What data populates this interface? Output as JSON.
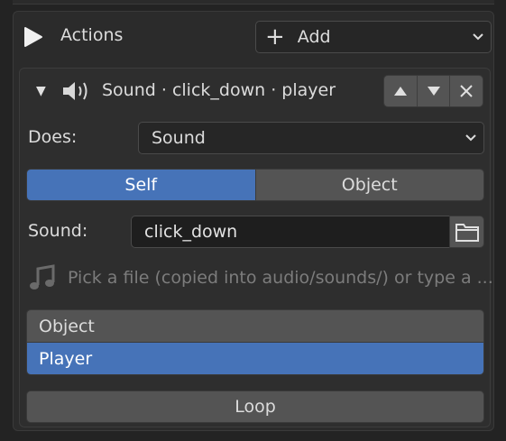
{
  "header": {
    "actions_label": "Actions",
    "add_label": "Add"
  },
  "action": {
    "title": "Sound · click_down · player",
    "icons": [
      "speaker-icon",
      "move-up-icon",
      "move-down-icon",
      "remove-icon"
    ],
    "does_label": "Does:",
    "does_value": "Sound",
    "target_options": [
      "Self",
      "Object"
    ],
    "target_selected": "Self",
    "sound_label": "Sound:",
    "sound_value": "click_down",
    "hint": "Pick a file (copied into audio/sounds/) or type a ...",
    "list_header": "Object",
    "list_selected": "Player",
    "loop_label": "Loop"
  },
  "colors": {
    "accent": "#4673b8",
    "panel": "#2e2e2e",
    "button": "#545454",
    "field": "#1e1e1e"
  }
}
